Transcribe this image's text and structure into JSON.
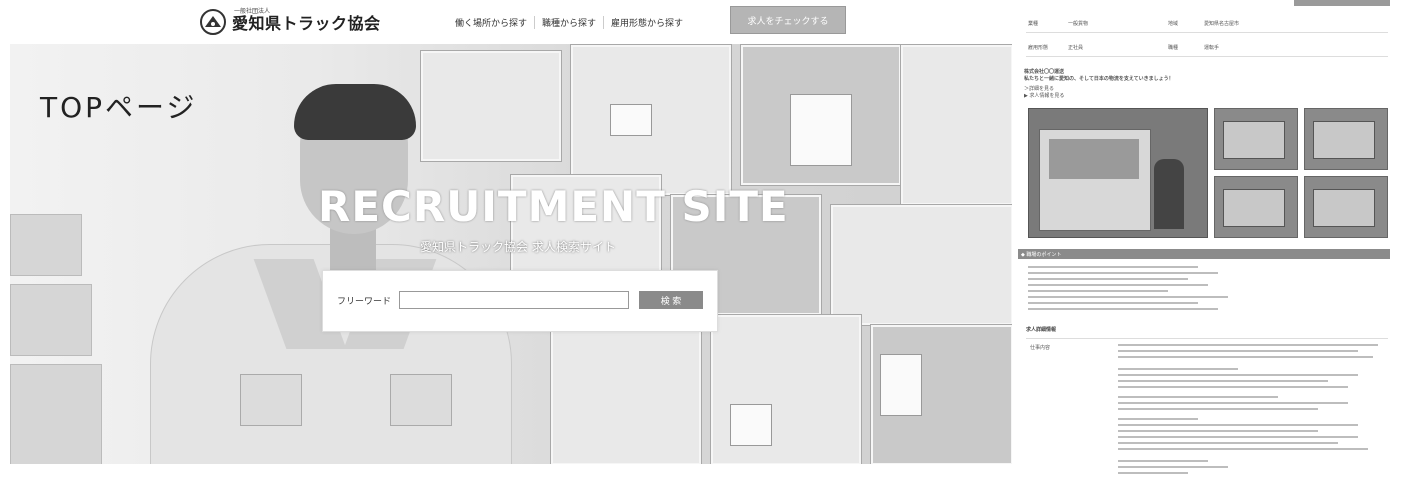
{
  "header": {
    "logo_small": "一般社団法人",
    "logo_name": "愛知県トラック協会",
    "nav": [
      "働く場所から探す",
      "職種から探す",
      "雇用形態から探す"
    ],
    "check_button": "求人をチェックする"
  },
  "page_label": "TOPページ",
  "hero": {
    "title": "RECRUITMENT SITE",
    "subtitle": "愛知県トラック協会 求人検索サイト"
  },
  "search": {
    "label": "フリーワード",
    "placeholder": "",
    "button": "検 索"
  },
  "detail": {
    "row1": [
      "業種",
      "一般貨物",
      "地域",
      "愛知県名古屋市"
    ],
    "row2": [
      "雇用形態",
      "正社員",
      "職種",
      "運転手"
    ],
    "company_note": "株式会社〇〇運送",
    "headline": "私たちと一緒に愛知の、そして日本の物流を支えていきましょう！",
    "link1": "＞詳細を見る",
    "link2": "▶ 求人情報を見る",
    "points_title": "◆ 職場のポイント",
    "info_title": "求人詳細情報",
    "info_label": "仕事内容"
  },
  "colors": {
    "check_button_bg": "#b5b5b5",
    "search_button_bg": "#8a8a8a",
    "points_bar_bg": "#8b8b8b"
  },
  "icons": {
    "logo": "truck-association-logo-icon"
  }
}
